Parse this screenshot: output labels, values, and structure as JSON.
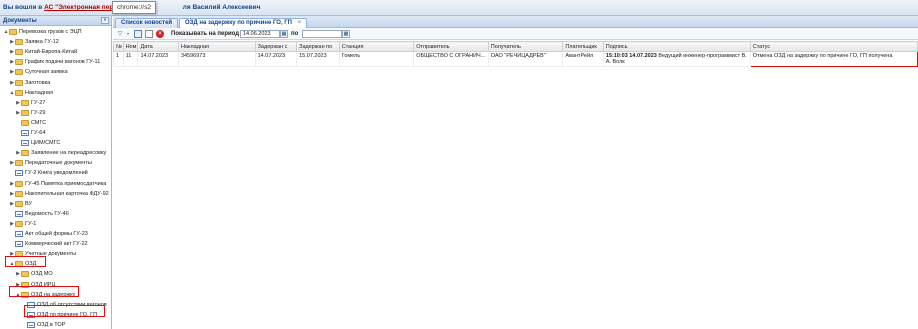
{
  "topbar": {
    "login_prefix": "Вы вошли в",
    "system_link": "АС \"Электронная перев",
    "user_suffix": "ля Василий Алексеевич"
  },
  "tooltip": {
    "text": "chrome://s2"
  },
  "left_panel": {
    "title": "Документы",
    "collapse_glyph": "«",
    "tree": [
      {
        "label": "Перевозка грузов с ЭЦП",
        "toggle": "▲",
        "icon": "folder"
      },
      {
        "label": "Заявка ГУ-12",
        "toggle": "▶",
        "icon": "folder"
      },
      {
        "label": "Китай-Европа-Китай",
        "toggle": "▶",
        "icon": "folder"
      },
      {
        "label": "График подачи вагонов ГУ-11",
        "toggle": "▶",
        "icon": "folder"
      },
      {
        "label": "Суточная заявка",
        "toggle": "▶",
        "icon": "folder"
      },
      {
        "label": "Заготовка",
        "toggle": "▶",
        "icon": "folder"
      },
      {
        "label": "Накладная",
        "toggle": "▲",
        "icon": "folder"
      },
      {
        "label": "ГУ-27",
        "toggle": "▶",
        "icon": "folder"
      },
      {
        "label": "ГУ-29",
        "toggle": "▶",
        "icon": "folder"
      },
      {
        "label": "СМГС",
        "toggle": "",
        "icon": "folder"
      },
      {
        "label": "ГУ-64",
        "toggle": "",
        "icon": "doc"
      },
      {
        "label": "ЦИМ/СМГС",
        "toggle": "",
        "icon": "doc"
      },
      {
        "label": "Заявление на переадресовку",
        "toggle": "▶",
        "icon": "folder"
      },
      {
        "label": "Передаточные документы",
        "toggle": "▶",
        "icon": "folder"
      },
      {
        "label": "ГУ-2 Книга уведомлений",
        "toggle": "",
        "icon": "doc"
      },
      {
        "label": "ГУ-45 Памятка приемосдатчика",
        "toggle": "▶",
        "icon": "folder"
      },
      {
        "label": "Накопительная карточка ФДУ-92",
        "toggle": "▶",
        "icon": "folder"
      },
      {
        "label": "ВУ",
        "toggle": "▶",
        "icon": "folder"
      },
      {
        "label": "Ведомость ГУ-46",
        "toggle": "",
        "icon": "doc"
      },
      {
        "label": "ГУ-1",
        "toggle": "▶",
        "icon": "folder"
      },
      {
        "label": "Акт общей формы ГУ-23",
        "toggle": "",
        "icon": "doc"
      },
      {
        "label": "Коммерческий акт ГУ-22",
        "toggle": "",
        "icon": "doc"
      },
      {
        "label": "Учетные документы",
        "toggle": "▶",
        "icon": "folder"
      },
      {
        "label": "ОЗД",
        "toggle": "▲",
        "icon": "folder"
      },
      {
        "label": "ОЗД МО",
        "toggle": "▶",
        "icon": "folder"
      },
      {
        "label": "ОЗД ИРЦ",
        "toggle": "▶",
        "icon": "folder"
      },
      {
        "label": "ОЗД на задержку",
        "toggle": "▲",
        "icon": "folder"
      },
      {
        "label": "ОЗД об отсутствии вагонов",
        "toggle": "",
        "icon": "doc"
      },
      {
        "label": "ОЗД по причине ГО, ГП",
        "toggle": "",
        "icon": "doc"
      },
      {
        "label": "ОЗД в ТОР",
        "toggle": "",
        "icon": "doc"
      }
    ]
  },
  "tabs": [
    {
      "label": "Список новостей",
      "close": "×"
    },
    {
      "label": "ОЗД на задержку по причине ГО, ГП",
      "close": "×"
    }
  ],
  "toolbar": {
    "filter_icon": "filter-icon",
    "period_label": "Показывать на период с",
    "date_from": "14.06.2023",
    "to_label": "по",
    "date_to": ""
  },
  "grid": {
    "columns": [
      "№",
      "Ном",
      "Дата",
      "Накладная",
      "Задержан с",
      "Задержан по",
      "Станция",
      "Отправитель",
      "Получатель",
      "Плательщик",
      "Подпись",
      "Статус"
    ],
    "rows": [
      {
        "num": "1",
        "nom": "11",
        "date": "14.07.2023",
        "waybill": "34596973",
        "held_from": "14.07.2023",
        "held_to": "15.07.2023",
        "station": "Гомель",
        "sender": "ОБЩЕСТВО С ОГРАНИЧ...",
        "receiver": "ОАО \"РЕЧИЦАДРЕВ\"",
        "payer": "АвантРейл",
        "signature_time": "15:10:03 14.07.2023",
        "signature_text": "Ведущий инженер-программист В. А. Волк",
        "status": "Отмена ОЗД на задержку по причине ГО, ГП получена"
      }
    ]
  }
}
